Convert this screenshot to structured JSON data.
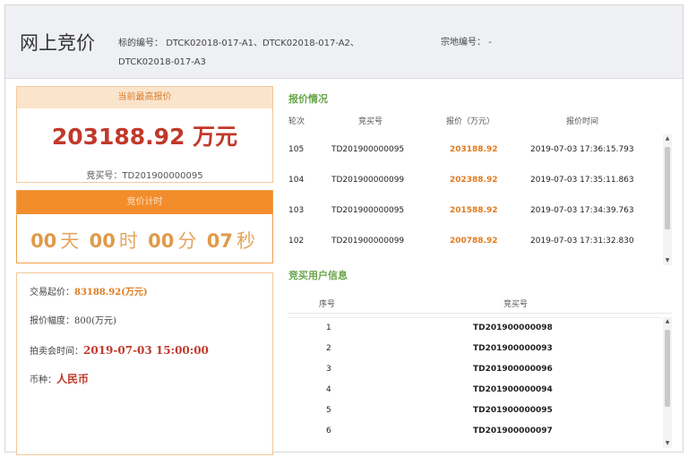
{
  "header": {
    "title": "网上竞价",
    "subject_label": "标的编号：",
    "subject_value_line1": "DTCK02018-017-A1、DTCK02018-017-A2、",
    "subject_value_line2": "DTCK02018-017-A3",
    "land_label": "宗地编号：",
    "land_value": "-"
  },
  "current": {
    "heading": "当前最高报价",
    "price": "203188.92 万元",
    "buyer_label": "竞买号：",
    "buyer_value": "TD201900000095"
  },
  "countdown": {
    "heading": "竞价计时",
    "days": "00",
    "days_unit": "天",
    "hours": "00",
    "hours_unit": "时",
    "minutes": "00",
    "minutes_unit": "分",
    "seconds": "07",
    "seconds_unit": "秒"
  },
  "info": {
    "start_label": "交易起价：",
    "start_value": "83188.92",
    "start_unit": "(万元)",
    "step_label": "报价幅度：",
    "step_value": "800",
    "step_unit": "(万元)",
    "auction_label": "拍卖会时间：",
    "auction_value": "2019-07-03 15:00:00",
    "currency_label": "币种：",
    "currency_value": "人民币"
  },
  "bids": {
    "title": "报价情况",
    "columns": [
      "轮次",
      "竞买号",
      "报价（万元）",
      "报价时间"
    ],
    "rows": [
      {
        "round": "105",
        "buyer": "TD201900000095",
        "price": "203188.92",
        "time": "2019-07-03 17:36:15.793"
      },
      {
        "round": "104",
        "buyer": "TD201900000099",
        "price": "202388.92",
        "time": "2019-07-03 17:35:11.863"
      },
      {
        "round": "103",
        "buyer": "TD201900000095",
        "price": "201588.92",
        "time": "2019-07-03 17:34:39.763"
      },
      {
        "round": "102",
        "buyer": "TD201900000099",
        "price": "200788.92",
        "time": "2019-07-03 17:31:32.830"
      }
    ]
  },
  "buyers": {
    "title": "竞买用户信息",
    "columns": [
      "序号",
      "竞买号"
    ],
    "rows": [
      {
        "n": "1",
        "id": "TD201900000098"
      },
      {
        "n": "2",
        "id": "TD201900000093"
      },
      {
        "n": "3",
        "id": "TD201900000096"
      },
      {
        "n": "4",
        "id": "TD201900000094"
      },
      {
        "n": "5",
        "id": "TD201900000095"
      },
      {
        "n": "6",
        "id": "TD201900000097"
      }
    ]
  },
  "icons": {
    "scroll_up": "▲",
    "scroll_down": "▼"
  }
}
